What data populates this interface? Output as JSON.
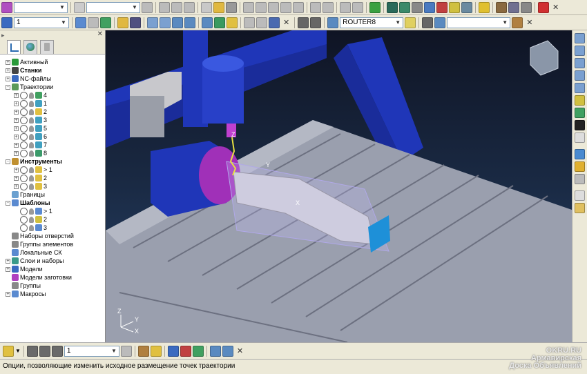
{
  "toolbar1": {
    "combo1_value": "",
    "combo2_value": ""
  },
  "toolbar2": {
    "layer_combo": "1",
    "machine_combo": "ROUTER8",
    "combo3_value": ""
  },
  "tree": {
    "items": [
      {
        "label": "Активный",
        "bold": false
      },
      {
        "label": "Станки",
        "bold": true
      },
      {
        "label": "NC-файлы",
        "bold": false
      },
      {
        "label": "Траектории",
        "bold": false
      },
      {
        "label": "4"
      },
      {
        "label": "1"
      },
      {
        "label": "2"
      },
      {
        "label": "3"
      },
      {
        "label": "5"
      },
      {
        "label": "6"
      },
      {
        "label": "7"
      },
      {
        "label": "8"
      },
      {
        "label": "Инструменты",
        "bold": true
      },
      {
        "label": "> 1"
      },
      {
        "label": "2"
      },
      {
        "label": "3"
      },
      {
        "label": "Границы"
      },
      {
        "label": "Шаблоны",
        "bold": true
      },
      {
        "label": "> 1"
      },
      {
        "label": "2"
      },
      {
        "label": "3"
      },
      {
        "label": "Наборы отверстий"
      },
      {
        "label": "Группы элементов"
      },
      {
        "label": "Локальные СК"
      },
      {
        "label": "Слои и наборы"
      },
      {
        "label": "Модели"
      },
      {
        "label": "Модели заготовки"
      },
      {
        "label": "Группы"
      },
      {
        "label": "Макросы"
      }
    ]
  },
  "viewport": {
    "axis_labels": [
      "Z",
      "Y",
      "X"
    ],
    "workpiece_axis": [
      "Y",
      "X",
      "Z"
    ],
    "colors": {
      "machine_blue": "#1f36b8",
      "table_gray": "#9a9fae",
      "spindle_magenta": "#b238c8",
      "fixture_gray": "#c8c8cc"
    }
  },
  "bottom_toolbar": {
    "combo_value": "1"
  },
  "status_text": "Опции, позволяющие изменить исходное размещение точек траектории",
  "watermark": {
    "line1": "OKRU.RU",
    "line2": "Армавирская",
    "line3": "Доска Объявлений"
  }
}
